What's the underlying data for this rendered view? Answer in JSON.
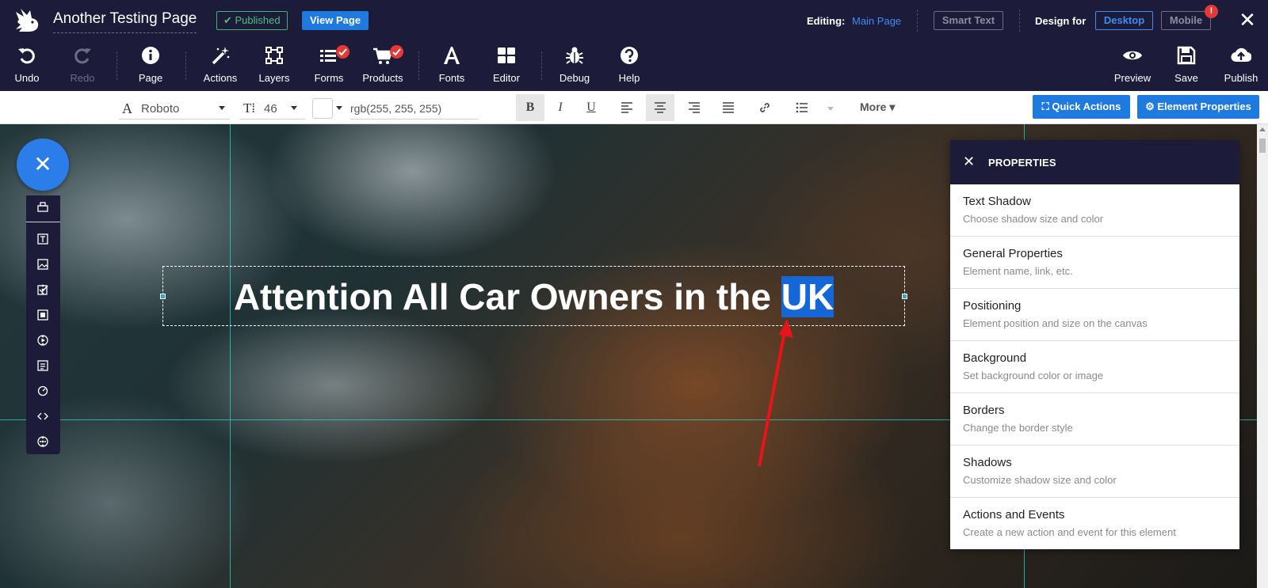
{
  "topbar": {
    "title": "Another Testing Page",
    "published_badge": "✔ Published",
    "view_page": "View Page",
    "editing_label": "Editing:",
    "editing_value": "Main Page",
    "smart_text": "Smart Text",
    "design_for_label": "Design for",
    "desktop": "Desktop",
    "mobile": "Mobile",
    "mobile_alert": "!",
    "close": "✕"
  },
  "toolbar": {
    "undo": "Undo",
    "redo": "Redo",
    "page": "Page",
    "actions": "Actions",
    "layers": "Layers",
    "forms": "Forms",
    "products": "Products",
    "fonts": "Fonts",
    "editor": "Editor",
    "debug": "Debug",
    "help": "Help",
    "preview": "Preview",
    "save": "Save",
    "publish": "Publish"
  },
  "formatbar": {
    "font_glyph": "A",
    "font_value": "Roboto",
    "size_glyph": "T⁞",
    "size_value": "46",
    "color_value": "rgb(255, 255, 255)",
    "bold": "B",
    "italic": "I",
    "underline": "U",
    "more": "More ▾",
    "quick_actions": "⛶ Quick Actions",
    "element_properties": "⚙ Element Properties"
  },
  "canvas": {
    "headline_main": "Attention All Car Owners in the ",
    "headline_selected": "UK"
  },
  "fab": {
    "close": "✕"
  },
  "properties": {
    "close": "✕",
    "title": "PROPERTIES",
    "items": [
      {
        "title": "Text Shadow",
        "desc": "Choose shadow size and color"
      },
      {
        "title": "General Properties",
        "desc": "Element name, link, etc."
      },
      {
        "title": "Positioning",
        "desc": "Element position and size on the canvas"
      },
      {
        "title": "Background",
        "desc": "Set background color or image"
      },
      {
        "title": "Borders",
        "desc": "Change the border style"
      },
      {
        "title": "Shadows",
        "desc": "Customize shadow size and color"
      },
      {
        "title": "Actions and Events",
        "desc": "Create a new action and event for this element"
      }
    ]
  },
  "colors": {
    "chrome": "#1c1b3a",
    "accent": "#1f7ae0",
    "published": "#4cc17d",
    "alert": "#e53935",
    "guide": "#2bd3cf",
    "selection": "#1566d6"
  }
}
